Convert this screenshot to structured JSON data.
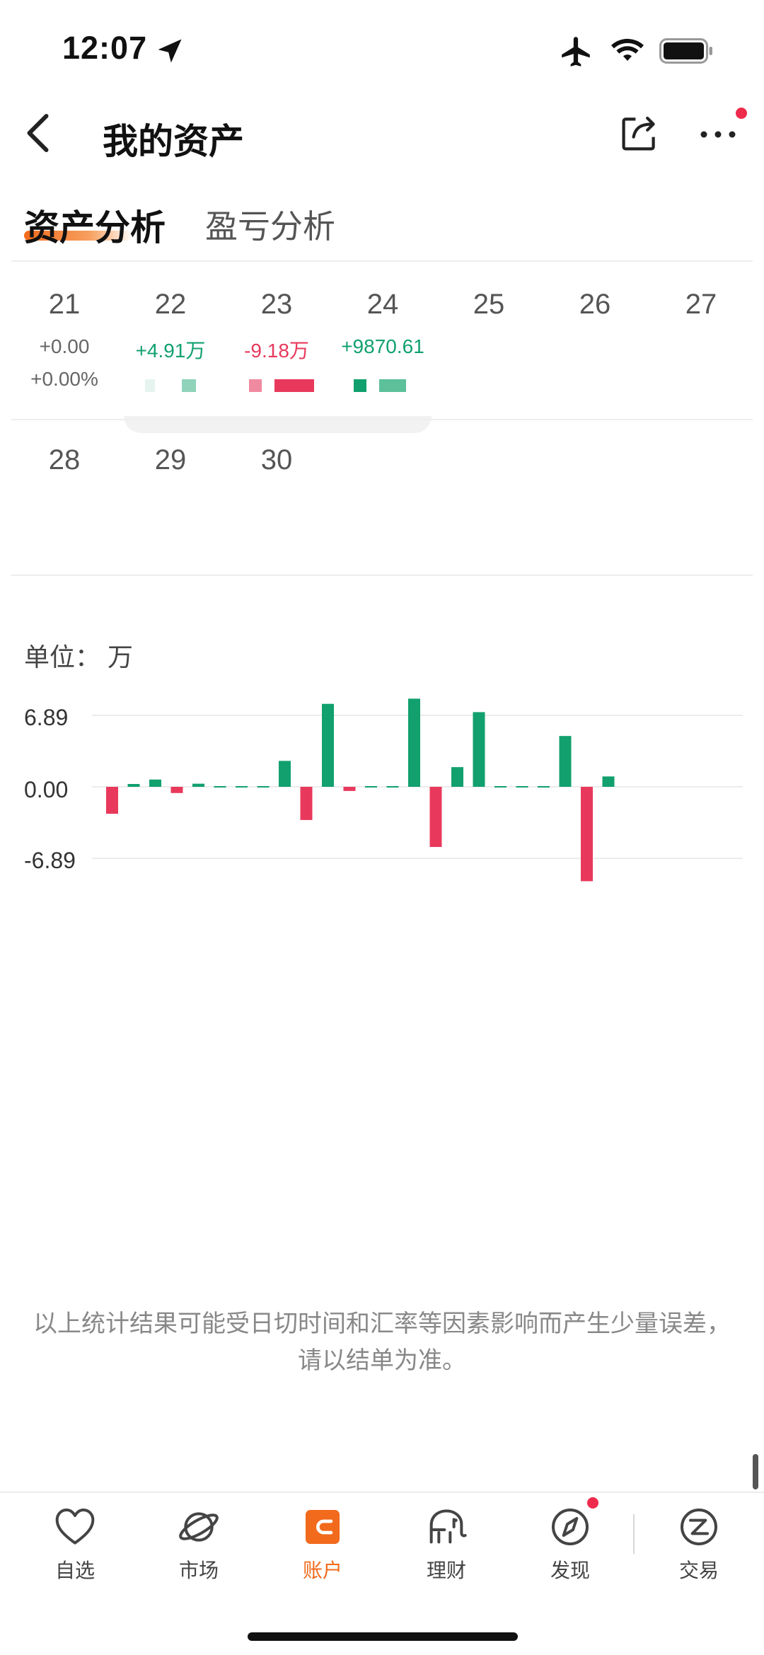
{
  "status_bar": {
    "time": "12:07"
  },
  "header": {
    "title": "我的资产"
  },
  "tabs": [
    {
      "label": "资产分析",
      "active": true
    },
    {
      "label": "盈亏分析",
      "active": false
    }
  ],
  "calendar": {
    "week1": [
      {
        "day": "21",
        "value": "+0.00",
        "percent": "+0.00%",
        "status": "flat"
      },
      {
        "day": "22",
        "value": "+4.91万",
        "status": "gain"
      },
      {
        "day": "23",
        "value": "-9.18万",
        "status": "loss"
      },
      {
        "day": "24",
        "value": "+9870.61",
        "status": "gain"
      },
      {
        "day": "25"
      },
      {
        "day": "26"
      },
      {
        "day": "27"
      }
    ],
    "week2": [
      {
        "day": "28"
      },
      {
        "day": "29"
      },
      {
        "day": "30"
      }
    ]
  },
  "chart": {
    "unit_label": "单位：  万",
    "ytick_top": "6.89",
    "ytick_mid": "0.00",
    "ytick_bottom": "-6.89"
  },
  "chart_data": {
    "type": "bar",
    "ylim": [
      -6.89,
      6.89
    ],
    "yticks": [
      "6.89",
      "0.00",
      "-6.89"
    ],
    "values": [
      -2.6,
      0.05,
      0.7,
      -0.6,
      0.3,
      0,
      0,
      0,
      2.5,
      -3.2,
      8.0,
      -0.4,
      0,
      0,
      8.5,
      -5.8,
      1.9,
      7.2,
      0,
      0,
      0,
      4.9,
      -9.1,
      1.0
    ],
    "colors": {
      "positive": "#11a06e",
      "negative": "#e8395c",
      "flat": "#11a06e"
    }
  },
  "footer_note": "以上统计结果可能受日切时间和汇率等因素影响而产生少量误差，请以结单为准。",
  "tabbar": {
    "items": [
      {
        "label": "自选",
        "icon": "heart-icon"
      },
      {
        "label": "市场",
        "icon": "planet-icon"
      },
      {
        "label": "账户",
        "icon": "wallet-icon",
        "active": true
      },
      {
        "label": "理财",
        "icon": "elephant-icon"
      },
      {
        "label": "发现",
        "icon": "compass-icon"
      },
      {
        "label": "交易",
        "icon": "trade-icon"
      }
    ]
  },
  "theme": {
    "accent": "#f26a1b",
    "gain": "#11a06e",
    "loss": "#e8395c",
    "badge": "#ee2b4c"
  }
}
